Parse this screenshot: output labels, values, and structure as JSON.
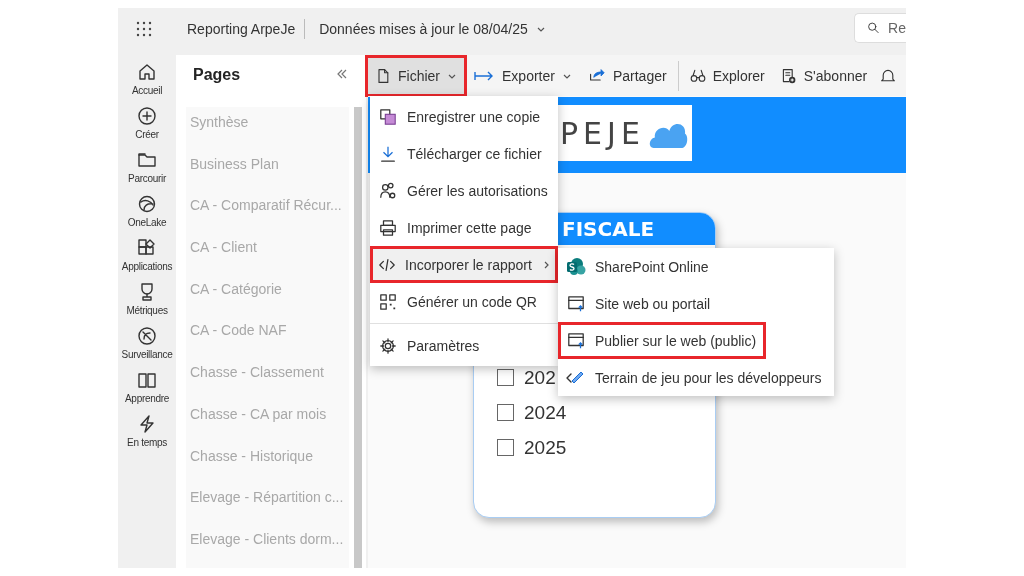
{
  "app": {
    "title": "Reporting ArpeJe",
    "subtitle": "Données mises à jour le 08/04/25",
    "search": {
      "placeholder": "Re"
    }
  },
  "rail": [
    "Accueil",
    "Créer",
    "Parcourir",
    "OneLake",
    "Applications",
    "Métriques",
    "Surveillance",
    "Apprendre",
    "En temps"
  ],
  "pages_pane": {
    "title": "Pages",
    "items": [
      "Synthèse",
      "Business Plan",
      "CA - Comparatif Récur...",
      "CA - Client",
      "CA - Catégorie",
      "CA - Code NAF",
      "Chasse - Classement",
      "Chasse - CA par mois",
      "Chasse - Historique",
      "Elevage - Répartition c...",
      "Elevage - Clients dorm..."
    ]
  },
  "toolbar": [
    {
      "label": "Fichier",
      "dropdown": true,
      "selected": true,
      "highlighted": true
    },
    {
      "label": "Exporter",
      "dropdown": true,
      "selected": false,
      "highlighted": false
    },
    {
      "label": "Partager",
      "dropdown": false,
      "selected": false,
      "highlighted": false
    },
    {
      "label": "Explorer",
      "dropdown": false,
      "selected": false,
      "highlighted": false
    },
    {
      "label": "S'abonner",
      "dropdown": false,
      "selected": false,
      "highlighted": false
    }
  ],
  "file_menu": [
    {
      "label": "Enregistrer une copie",
      "submenu": false,
      "selected": false,
      "highlighted": false,
      "divider_before": false
    },
    {
      "label": "Télécharger ce fichier",
      "submenu": false,
      "selected": false,
      "highlighted": false,
      "divider_before": false
    },
    {
      "label": "Gérer les autorisations",
      "submenu": false,
      "selected": false,
      "highlighted": false,
      "divider_before": false
    },
    {
      "label": "Imprimer cette page",
      "submenu": false,
      "selected": false,
      "highlighted": false,
      "divider_before": false
    },
    {
      "label": "Incorporer le rapport",
      "submenu": true,
      "selected": true,
      "highlighted": true,
      "divider_before": false
    },
    {
      "label": "Générer un code QR",
      "submenu": false,
      "selected": false,
      "highlighted": false,
      "divider_before": false
    },
    {
      "label": "Paramètres",
      "submenu": false,
      "selected": false,
      "highlighted": false,
      "divider_before": true
    }
  ],
  "embed_submenu": [
    {
      "label": "SharePoint Online",
      "highlighted": false
    },
    {
      "label": "Site web ou portail",
      "highlighted": false
    },
    {
      "label": "Publier sur le web (public)",
      "highlighted": true
    },
    {
      "label": "Terrain de jeu pour les développeurs",
      "highlighted": false
    }
  ],
  "report": {
    "logo_text": "PEJE",
    "card_title": "FISCALE",
    "years": [
      {
        "label": "202",
        "checked": false
      },
      {
        "label": "2024",
        "checked": false
      },
      {
        "label": "2025",
        "checked": false
      }
    ]
  }
}
